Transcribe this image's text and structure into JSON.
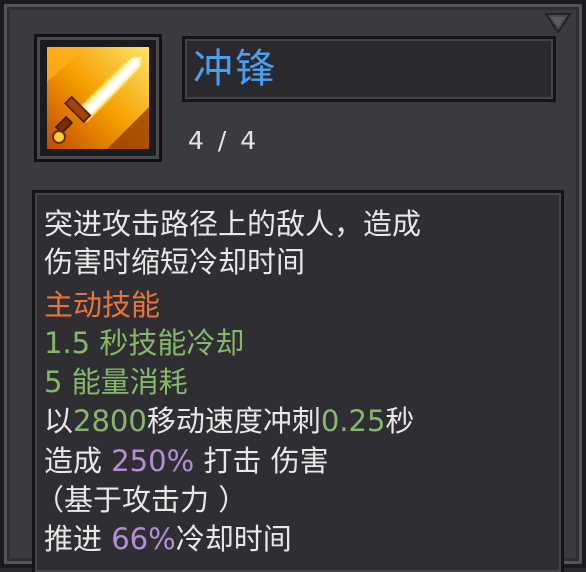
{
  "skill": {
    "name": "冲锋",
    "level": "4 / 4",
    "icon": "glowing-sword-icon",
    "description": [
      "突进攻击路径上的敌人，造成",
      "伤害时缩短冷却时间"
    ],
    "type_label": "主动技能",
    "cooldown": {
      "value": "1.5",
      "label": "秒技能冷却"
    },
    "energy": {
      "value": "5",
      "label": "能量消耗"
    },
    "dash": {
      "prefix": "以",
      "speed": "2800",
      "mid": "移动速度冲刺",
      "duration": "0.25",
      "suffix": "秒"
    },
    "damage": {
      "prefix": "造成",
      "value": "250%",
      "suffix": "打击 伤害"
    },
    "damage_note": "（基于攻击力 ）",
    "push": {
      "prefix": "推进",
      "value": "66%",
      "suffix": "冷却时间"
    }
  },
  "colors": {
    "title": "#4a9ff0",
    "text": "#e8e8e8",
    "skill_type": "#e8743c",
    "stat_value": "#86b86a",
    "percent": "#b58fd6"
  }
}
